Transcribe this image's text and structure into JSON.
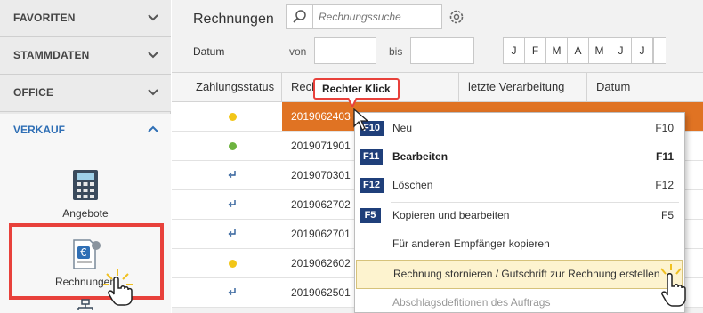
{
  "sidebar": {
    "sections": [
      {
        "label": "FAVORITEN"
      },
      {
        "label": "STAMMDATEN"
      },
      {
        "label": "OFFICE"
      }
    ],
    "verkauf": {
      "label": "VERKAUF",
      "items": [
        {
          "label": "Angebote",
          "icon": "calculator-icon"
        },
        {
          "label": "Rechnungen",
          "icon": "invoice-icon"
        }
      ]
    }
  },
  "header": {
    "title": "Rechnungen",
    "search_placeholder": "Rechnungssuche"
  },
  "filter": {
    "datum_label": "Datum",
    "von_label": "von",
    "bis_label": "bis",
    "months": [
      "J",
      "F",
      "M",
      "A",
      "M",
      "J",
      "J"
    ]
  },
  "table": {
    "columns": [
      "Zahlungsstatus",
      "Rech",
      "letzte Verarbeitung",
      "Datum"
    ],
    "rows": [
      {
        "status": "yellow",
        "number": "2019062403",
        "selected": true
      },
      {
        "status": "green",
        "number": "2019071901"
      },
      {
        "status": "arrow",
        "number": "2019070301"
      },
      {
        "status": "arrow",
        "number": "2019062702"
      },
      {
        "status": "arrow",
        "number": "2019062701"
      },
      {
        "status": "yellow",
        "number": "2019062602"
      },
      {
        "status": "arrow",
        "number": "2019062501"
      }
    ]
  },
  "tooltip": {
    "text": "Rechter Klick"
  },
  "context_menu": {
    "items": [
      {
        "key": "F10",
        "label": "Neu",
        "shortcut": "F10"
      },
      {
        "key": "F11",
        "label": "Bearbeiten",
        "shortcut": "F11",
        "bold": true
      },
      {
        "key": "F12",
        "label": "Löschen",
        "shortcut": "F12"
      },
      {
        "key": "F5",
        "label": "Kopieren und bearbeiten",
        "shortcut": "F5"
      },
      {
        "label": "Für anderen Empfänger kopieren"
      },
      {
        "label": "Rechnung stornieren / Gutschrift zur Rechnung erstellen",
        "hover": true
      },
      {
        "label": "Abschlagsdefitionen des Auftrags",
        "disabled": true
      }
    ]
  },
  "colors": {
    "accent_blue": "#2f6fb5",
    "selected_orange": "#e07323",
    "highlight_red": "#e8413b",
    "key_badge": "#1f3f7a",
    "status_yellow": "#f2c618",
    "status_green": "#6db33f"
  }
}
